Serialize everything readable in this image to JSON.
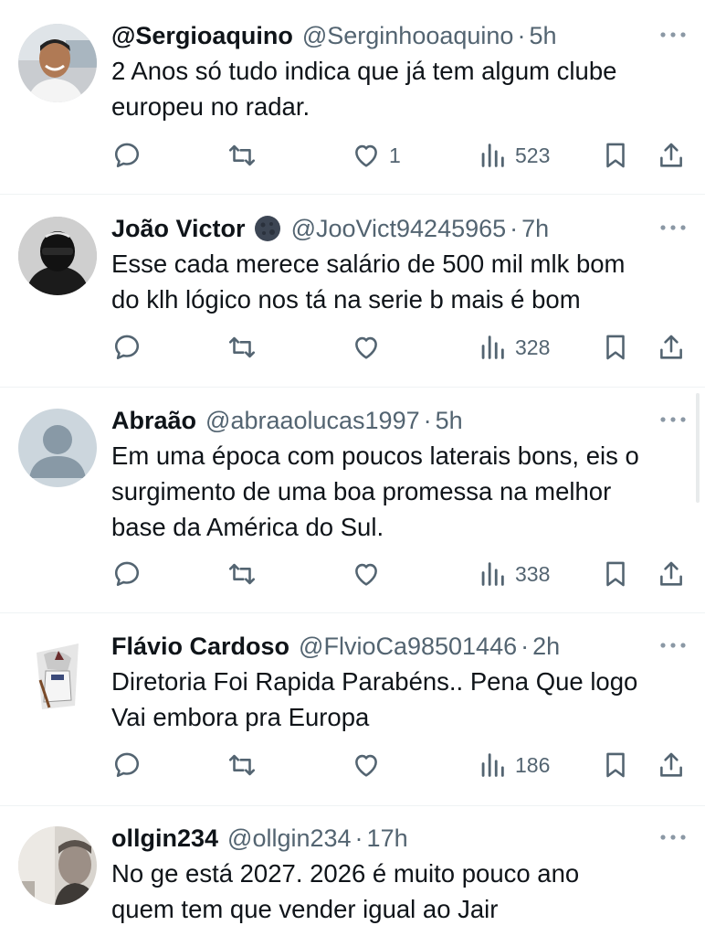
{
  "tweets": [
    {
      "display_name": "@Sergioaquino",
      "handle": "@Serginhooaquino",
      "separator": "·",
      "time": "5h",
      "text": "2 Anos só tudo indica que já tem algum clube\neuropeu no radar.",
      "likes": "1",
      "views": "523"
    },
    {
      "display_name": "João Victor",
      "handle": "@JooVict94245965",
      "separator": "·",
      "time": "7h",
      "text": "Esse cada merece salário de 500 mil mlk bom\ndo klh lógico nos tá na serie b mais é bom",
      "likes": "",
      "views": "328"
    },
    {
      "display_name": "Abraão",
      "handle": "@abraaolucas1997",
      "separator": "·",
      "time": "5h",
      "text": "Em uma época com poucos laterais bons, eis o\nsurgimento de uma boa promessa na melhor\nbase da América do Sul.",
      "likes": "",
      "views": "338"
    },
    {
      "display_name": "Flávio Cardoso",
      "handle": "@FlvioCa98501446",
      "separator": "·",
      "time": "2h",
      "text": "Diretoria Foi Rapida Parabéns.. Pena Que logo\nVai embora pra Europa",
      "likes": "",
      "views": "186"
    },
    {
      "display_name": "ollgin234",
      "handle": "@ollgin234",
      "separator": "·",
      "time": "17h",
      "text": "No ge está 2027.  2026 é  muito pouco ano\nquem tem que vender igual ao Jair",
      "likes": "",
      "views": ""
    }
  ],
  "icons": {
    "reply": "reply-icon",
    "retweet": "retweet-icon",
    "like": "heart-icon",
    "views": "views-chart-icon",
    "bookmark": "bookmark-icon",
    "share": "share-icon",
    "more": "more-dots-icon"
  },
  "colors": {
    "text": "#0f1419",
    "secondary": "#536471",
    "divider": "#eff3f4"
  }
}
